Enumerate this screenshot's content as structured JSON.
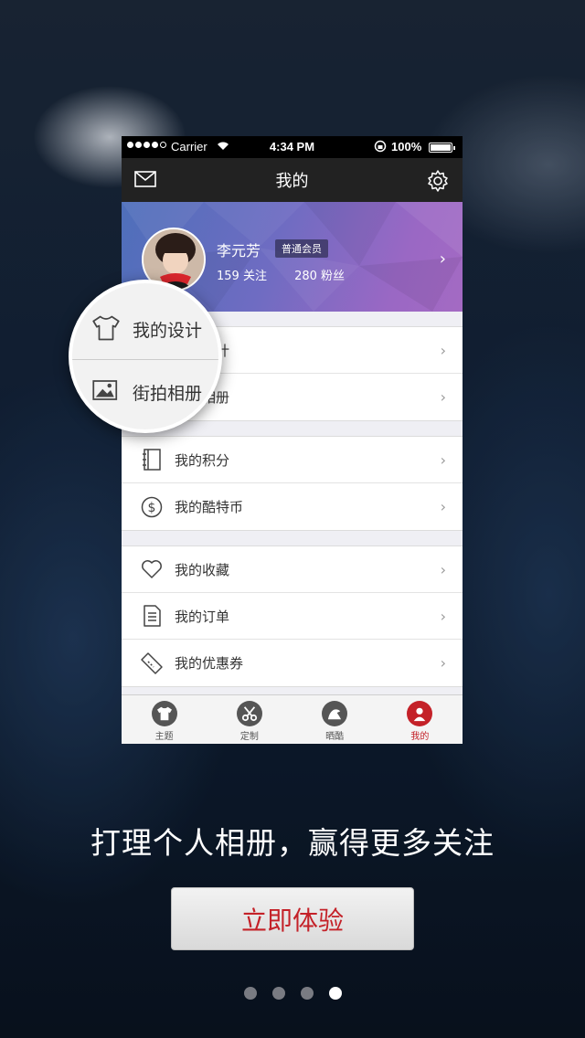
{
  "status_bar": {
    "carrier": "Carrier",
    "time": "4:34 PM",
    "battery": "100%"
  },
  "nav": {
    "title": "我的"
  },
  "profile": {
    "name": "李元芳",
    "badge": "普通会员",
    "following": "159 关注",
    "fans": "280 粉丝"
  },
  "menu_groups": [
    [
      {
        "label": "我的设计",
        "icon": "tshirt-icon"
      },
      {
        "label": "街拍相册",
        "icon": "photo-icon"
      }
    ],
    [
      {
        "label": "我的积分",
        "icon": "notebook-icon"
      },
      {
        "label": "我的酷特币",
        "icon": "dollar-icon"
      }
    ],
    [
      {
        "label": "我的收藏",
        "icon": "heart-icon"
      },
      {
        "label": "我的订单",
        "icon": "order-icon"
      },
      {
        "label": "我的优惠券",
        "icon": "coupon-icon"
      }
    ]
  ],
  "tabs": [
    {
      "label": "主题"
    },
    {
      "label": "定制"
    },
    {
      "label": "晒酷"
    },
    {
      "label": "我的",
      "active": true
    }
  ],
  "magnifier": {
    "item1": "我的设计",
    "item2": "街拍相册"
  },
  "caption": "打理个人相册，赢得更多关注",
  "cta": "立即体验",
  "pager": {
    "total": 4,
    "current": 4
  },
  "colors": {
    "accent": "#c42128",
    "nav": "#222222",
    "profile_start": "#4e6fba",
    "profile_end": "#a46ac3"
  }
}
